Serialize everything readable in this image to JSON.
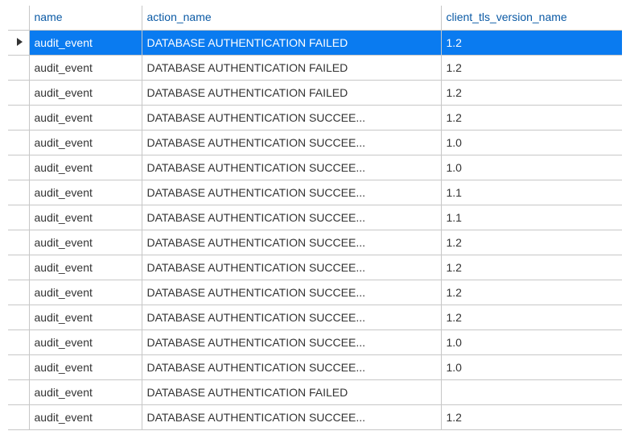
{
  "columns": {
    "name": "name",
    "action_name": "action_name",
    "client_tls_version_name": "client_tls_version_name"
  },
  "selected_index": 0,
  "rows": [
    {
      "name": "audit_event",
      "action_name": "DATABASE AUTHENTICATION FAILED",
      "client_tls_version_name": "1.2"
    },
    {
      "name": "audit_event",
      "action_name": "DATABASE AUTHENTICATION FAILED",
      "client_tls_version_name": "1.2"
    },
    {
      "name": "audit_event",
      "action_name": "DATABASE AUTHENTICATION FAILED",
      "client_tls_version_name": "1.2"
    },
    {
      "name": "audit_event",
      "action_name": "DATABASE AUTHENTICATION SUCCEE...",
      "client_tls_version_name": "1.2"
    },
    {
      "name": "audit_event",
      "action_name": "DATABASE AUTHENTICATION SUCCEE...",
      "client_tls_version_name": "1.0"
    },
    {
      "name": "audit_event",
      "action_name": "DATABASE AUTHENTICATION SUCCEE...",
      "client_tls_version_name": "1.0"
    },
    {
      "name": "audit_event",
      "action_name": "DATABASE AUTHENTICATION SUCCEE...",
      "client_tls_version_name": "1.1"
    },
    {
      "name": "audit_event",
      "action_name": "DATABASE AUTHENTICATION SUCCEE...",
      "client_tls_version_name": "1.1"
    },
    {
      "name": "audit_event",
      "action_name": "DATABASE AUTHENTICATION SUCCEE...",
      "client_tls_version_name": "1.2"
    },
    {
      "name": "audit_event",
      "action_name": "DATABASE AUTHENTICATION SUCCEE...",
      "client_tls_version_name": "1.2"
    },
    {
      "name": "audit_event",
      "action_name": "DATABASE AUTHENTICATION SUCCEE...",
      "client_tls_version_name": "1.2"
    },
    {
      "name": "audit_event",
      "action_name": "DATABASE AUTHENTICATION SUCCEE...",
      "client_tls_version_name": "1.2"
    },
    {
      "name": "audit_event",
      "action_name": "DATABASE AUTHENTICATION SUCCEE...",
      "client_tls_version_name": "1.0"
    },
    {
      "name": "audit_event",
      "action_name": "DATABASE AUTHENTICATION SUCCEE...",
      "client_tls_version_name": "1.0"
    },
    {
      "name": "audit_event",
      "action_name": "DATABASE AUTHENTICATION FAILED",
      "client_tls_version_name": ""
    },
    {
      "name": "audit_event",
      "action_name": "DATABASE AUTHENTICATION SUCCEE...",
      "client_tls_version_name": "1.2"
    }
  ]
}
